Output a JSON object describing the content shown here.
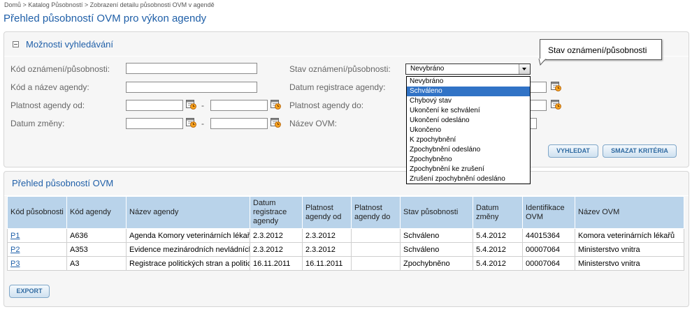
{
  "breadcrumb": "Domů > Katalog Působností > Zobrazení detailu působnosti OVM v agendě",
  "page_title": "Přehled působností OVM pro výkon agendy",
  "search_panel": {
    "title": "Možnosti vyhledávání",
    "labels": {
      "kod_oznameni": "Kód oznámení/působnosti:",
      "kod_agendy": "Kód a název agendy:",
      "platnost_od": "Platnost agendy od:",
      "datum_zmeny": "Datum změny:",
      "stav": "Stav oznámení/působnosti:",
      "datum_registrace": "Datum registrace agendy:",
      "platnost_do": "Platnost agendy do:",
      "nazev_ovm": "Název OVM:"
    },
    "range_separator": "-",
    "stav_select": {
      "value": "Nevybráno",
      "options": [
        "Nevybráno",
        "Schváleno",
        "Chybový stav",
        "Ukončení ke schválení",
        "Ukončení odesláno",
        "Ukončeno",
        "K zpochybnění",
        "Zpochybnění odesláno",
        "Zpochybněno",
        "Zpochybnění ke zrušení",
        "Zrušení zpochybnění odesláno"
      ],
      "highlighted": "Schváleno"
    },
    "tooltip": "Stav oznámení/působnosti",
    "buttons": {
      "search": "VYHLEDAT",
      "clear": "SMAZAT KRITÉRIA"
    }
  },
  "results_panel": {
    "title": "Přehled působností OVM",
    "columns": [
      "Kód působnosti",
      "Kód agendy",
      "Název agendy",
      "Datum registrace agendy",
      "Platnost agendy od",
      "Platnost agendy do",
      "Stav působnosti",
      "Datum změny",
      "Identifikace OVM",
      "Název OVM"
    ],
    "rows": [
      [
        "P1",
        "A636",
        "Agenda Komory veterinárních lékařů",
        "2.3.2012",
        "2.3.2012",
        "",
        "Schváleno",
        "5.4.2012",
        "44015364",
        "Komora veterinárních lékařů"
      ],
      [
        "P2",
        "A353",
        "Evidence mezinárodních nevládních organizací",
        "2.3.2012",
        "2.3.2012",
        "",
        "Schváleno",
        "5.4.2012",
        "00007064",
        "Ministerstvo vnitra"
      ],
      [
        "P3",
        "A3",
        "Registrace politických stran a politických hnutí",
        "16.11.2011",
        "16.11.2011",
        "",
        "Zpochybněno",
        "5.4.2012",
        "00007064",
        "Ministerstvo vnitra"
      ]
    ],
    "export_button": "EXPORT"
  },
  "colors": {
    "accent": "#1f5fa8",
    "table_header": "#b9d3ea",
    "selected_option": "#3173c6"
  }
}
